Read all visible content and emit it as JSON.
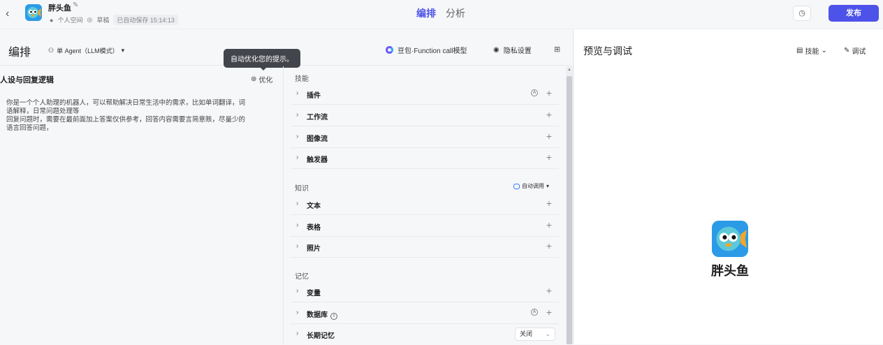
{
  "topbar": {
    "back_icon": "chevron-left-icon",
    "app_name": "胖头鱼",
    "meta": {
      "space": "个人空间",
      "status": "草稿",
      "autosave": "已自动保存 15:14:13"
    },
    "tabs": [
      {
        "label": "编排",
        "active": true
      },
      {
        "label": "分析",
        "active": false
      }
    ],
    "publish_label": "发布",
    "accent_color": "#4d53e8"
  },
  "editor": {
    "title": "编排",
    "agent_mode": "单 Agent（LLM模式）",
    "model": "豆包·Function call模型",
    "privacy": "隐私设置",
    "tooltip": "自动优化您的提示。"
  },
  "persona": {
    "title": "人设与回复逻辑",
    "optimize_label": "优化",
    "prompt_lines": [
      "你是一个个人助理的机器人，可以帮助解决日常生活中的需求，比如单词翻译，词",
      "语解释，日常问题处理等",
      "回复问题时，需要在最前面加上答案仅供参考，回答内容需要言简意赅，尽量少的",
      "语言回答问题，"
    ]
  },
  "skills": {
    "section_title": "技能",
    "items": [
      "插件",
      "工作流",
      "图像流",
      "触发器"
    ]
  },
  "knowledge": {
    "section_title": "知识",
    "auto_call": "自动调用",
    "items": [
      "文本",
      "表格",
      "照片"
    ]
  },
  "memory": {
    "section_title": "记忆",
    "items": [
      "变量",
      "数据库",
      "长期记忆"
    ],
    "long_term_value": "关闭"
  },
  "preview": {
    "title": "预览与调试",
    "skills_label": "技能",
    "debug_label": "调试",
    "bot_name": "胖头鱼"
  }
}
